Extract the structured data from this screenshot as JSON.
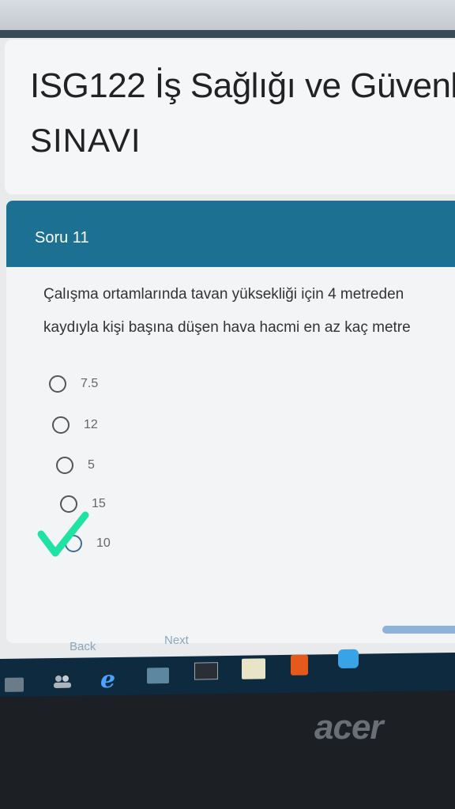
{
  "page": {
    "title_line1": "ISG122 İş Sağlığı ve Güvenl",
    "title_line2": "SINAVI"
  },
  "question": {
    "header": "Soru 11",
    "text_line1": "Çalışma ortamlarında tavan yüksekliği için 4 metreden",
    "text_line2": "kaydıyla kişi başına düşen hava hacmi en az kaç metre",
    "options": [
      {
        "label": "7.5",
        "selected": false
      },
      {
        "label": "12",
        "selected": false
      },
      {
        "label": "5",
        "selected": false
      },
      {
        "label": "15",
        "selected": false
      },
      {
        "label": "10",
        "selected": true
      }
    ],
    "selected_index": 4
  },
  "navigation": {
    "back_label": "Back",
    "next_label": "Next"
  },
  "taskbar": {
    "icons": [
      "start-icon",
      "people-icon",
      "edge-icon",
      "window-icon",
      "terminal-icon",
      "store-icon",
      "office-icon",
      "zoom-icon"
    ]
  },
  "device": {
    "brand": "acer"
  },
  "colors": {
    "header_blue": "#1c7193",
    "checkmark_green": "#1fe3a3",
    "taskbar": "#0e2a3f"
  }
}
